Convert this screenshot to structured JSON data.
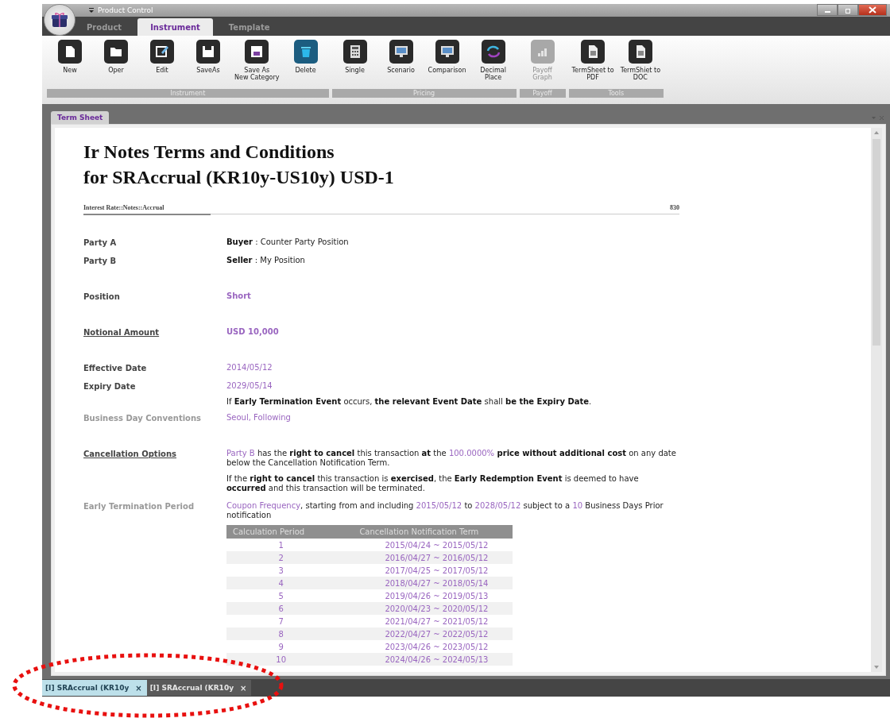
{
  "window": {
    "title": "Product Control"
  },
  "ribbon_tabs": [
    {
      "label": "Product",
      "selected": false
    },
    {
      "label": "Instrument",
      "selected": true
    },
    {
      "label": "Template",
      "selected": false
    }
  ],
  "ribbon_groups": [
    {
      "label": "Instrument",
      "buttons": [
        {
          "label": "New",
          "kind": "new",
          "disabled": false
        },
        {
          "label": "Oper",
          "kind": "open",
          "disabled": false
        },
        {
          "label": "Edit",
          "kind": "edit",
          "disabled": false
        },
        {
          "label": "SaveAs",
          "kind": "save",
          "disabled": false
        },
        {
          "label": "Save As\nNew Category",
          "kind": "save-category",
          "disabled": false
        },
        {
          "label": "Delete",
          "kind": "delete",
          "disabled": false
        }
      ]
    },
    {
      "label": "Pricing",
      "buttons": [
        {
          "label": "Single",
          "kind": "calculator",
          "disabled": false
        },
        {
          "label": "Scenario",
          "kind": "monitor",
          "disabled": false
        },
        {
          "label": "Comparison",
          "kind": "monitor",
          "disabled": false
        },
        {
          "label": "Decimal\nPlace",
          "kind": "refresh",
          "disabled": false
        }
      ]
    },
    {
      "label": "Payoff",
      "buttons": [
        {
          "label": "Payoff\nGraph",
          "kind": "chart",
          "disabled": true
        }
      ]
    },
    {
      "label": "Tools",
      "buttons": [
        {
          "label": "TermSheet to\nPDF",
          "kind": "document",
          "disabled": false
        },
        {
          "label": "TermShiet to\nDOC",
          "kind": "document",
          "disabled": false
        }
      ]
    }
  ],
  "doc_tab": {
    "label": "Term Sheet"
  },
  "term_sheet": {
    "title_lines": [
      "Ir Notes Terms and Conditions",
      "for SRAccrual (KR10y-US10y) USD-1"
    ],
    "category": "Interest Rate::Notes::Accrual",
    "code": "830",
    "rows": [
      {
        "label": "Party A",
        "kind": "normal",
        "paragraphs": [
          [
            {
              "t": "Buyer",
              "kind": "bold"
            },
            {
              "t": " : Counter Party Position",
              "kind": "plain"
            }
          ]
        ]
      },
      {
        "label": "Party B",
        "kind": "normal",
        "paragraphs": [
          [
            {
              "t": "Seller",
              "kind": "bold"
            },
            {
              "t": " : My Position",
              "kind": "plain"
            }
          ]
        ]
      },
      {
        "label": "Position",
        "kind": "normal",
        "paragraphs": [
          [
            {
              "t": "Short",
              "kind": "violet-bold"
            }
          ]
        ]
      },
      {
        "label": "Notional Amount",
        "kind": "underlined",
        "paragraphs": [
          [
            {
              "t": "USD 10,000",
              "kind": "violet-bold"
            }
          ]
        ]
      },
      {
        "label": "Effective Date",
        "kind": "normal",
        "paragraphs": [
          [
            {
              "t": "2014/05/12",
              "kind": "violet"
            }
          ]
        ]
      },
      {
        "label": "Expiry Date",
        "kind": "normal",
        "paragraphs": [
          [
            {
              "t": "2029/05/14",
              "kind": "violet"
            }
          ],
          [
            {
              "t": "If ",
              "kind": "plain"
            },
            {
              "t": "Early Termination Event",
              "kind": "bold"
            },
            {
              "t": " occurs, ",
              "kind": "plain"
            },
            {
              "t": "the relevant Event Date",
              "kind": "bold"
            },
            {
              "t": " shall ",
              "kind": "plain"
            },
            {
              "t": "be the Expiry Date",
              "kind": "bold"
            },
            {
              "t": ".",
              "kind": "plain"
            }
          ]
        ]
      },
      {
        "label": "Business Day Conventions",
        "kind": "muted",
        "paragraphs": [
          [
            {
              "t": "Seoul, Following",
              "kind": "violet"
            }
          ]
        ]
      },
      {
        "label": "Cancellation Options",
        "kind": "underlined",
        "paragraphs": [
          [
            {
              "t": "Party B",
              "kind": "violet"
            },
            {
              "t": " has the ",
              "kind": "plain"
            },
            {
              "t": "right to cancel",
              "kind": "bold"
            },
            {
              "t": " this transaction ",
              "kind": "plain"
            },
            {
              "t": "at",
              "kind": "bold"
            },
            {
              "t": " the ",
              "kind": "plain"
            },
            {
              "t": "100.0000%",
              "kind": "violet"
            },
            {
              "t": " price without additional cost",
              "kind": "bold"
            },
            {
              "t": " on any date below the Cancellation Notification Term.",
              "kind": "plain"
            }
          ],
          [
            {
              "t": "If the ",
              "kind": "plain"
            },
            {
              "t": "right to cancel",
              "kind": "bold"
            },
            {
              "t": " this transaction is ",
              "kind": "plain"
            },
            {
              "t": "exercised",
              "kind": "bold"
            },
            {
              "t": ", the ",
              "kind": "plain"
            },
            {
              "t": "Early Redemption Event",
              "kind": "bold"
            },
            {
              "t": " is deemed to have ",
              "kind": "plain"
            },
            {
              "t": "occurred",
              "kind": "bold"
            },
            {
              "t": " and this transaction will be terminated.",
              "kind": "plain"
            }
          ]
        ]
      },
      {
        "label": "Early Termination Period",
        "kind": "muted",
        "paragraphs": [
          [
            {
              "t": "Coupon Frequency",
              "kind": "violet"
            },
            {
              "t": ", starting from and including ",
              "kind": "plain"
            },
            {
              "t": "2015/05/12",
              "kind": "violet"
            },
            {
              "t": " to ",
              "kind": "plain"
            },
            {
              "t": "2028/05/12",
              "kind": "violet"
            },
            {
              "t": " subject to a ",
              "kind": "plain"
            },
            {
              "t": "10",
              "kind": "violet"
            },
            {
              "t": " Business Days Prior notification",
              "kind": "plain"
            }
          ]
        ]
      }
    ],
    "table": {
      "columns": [
        "Calculation Period",
        "Cancellation Notification Term"
      ],
      "rows": [
        [
          "1",
          "2015/04/24 ~ 2015/05/12"
        ],
        [
          "2",
          "2016/04/27 ~ 2016/05/12"
        ],
        [
          "3",
          "2017/04/25 ~ 2017/05/12"
        ],
        [
          "4",
          "2018/04/27 ~ 2018/05/14"
        ],
        [
          "5",
          "2019/04/26 ~ 2019/05/13"
        ],
        [
          "6",
          "2020/04/23 ~ 2020/05/12"
        ],
        [
          "7",
          "2021/04/27 ~ 2021/05/12"
        ],
        [
          "8",
          "2022/04/27 ~ 2022/05/12"
        ],
        [
          "9",
          "2023/04/26 ~ 2023/05/12"
        ],
        [
          "10",
          "2024/04/26 ~ 2024/05/13"
        ]
      ]
    }
  },
  "bottom_tabs": [
    {
      "label": "[I] SRAccrual (KR10y",
      "close": "×",
      "selected": true
    },
    {
      "label": "[I] SRAccrual (KR10y",
      "close": "×",
      "selected": false
    }
  ]
}
